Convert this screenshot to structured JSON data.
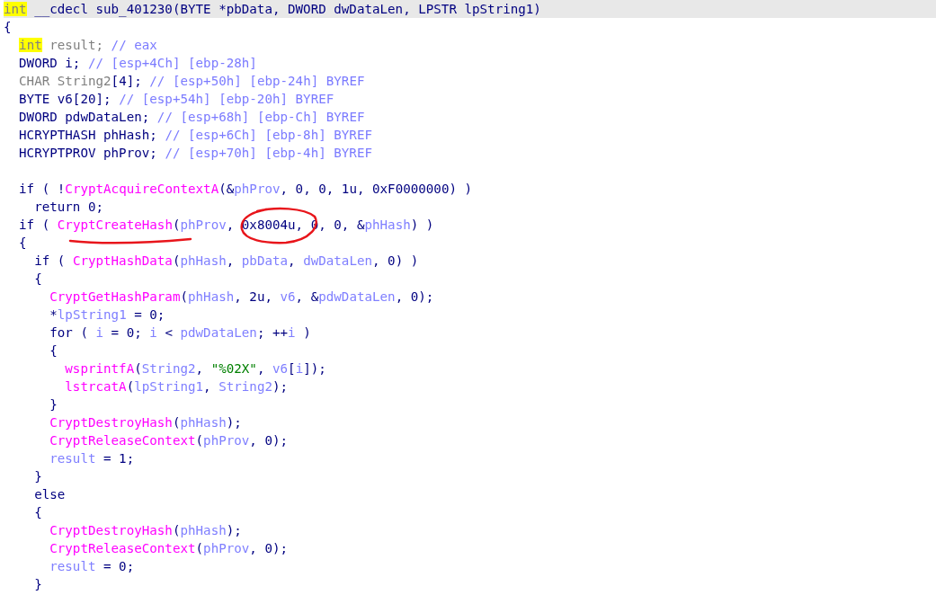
{
  "lines": [
    {
      "current": true,
      "tokens": [
        {
          "kind": "keyword",
          "t": "int"
        },
        {
          "kind": "plain",
          "t": " __cdecl sub_401230(BYTE *pbData, DWORD dwDataLen, LPSTR lpString1)"
        }
      ]
    },
    {
      "current": false,
      "tokens": [
        {
          "kind": "plain",
          "t": "{"
        }
      ]
    },
    {
      "current": false,
      "tokens": [
        {
          "kind": "keyword",
          "t": "  int"
        },
        {
          "kind": "type",
          "t": " result; "
        },
        {
          "kind": "comment",
          "t": "// eax"
        }
      ]
    },
    {
      "current": false,
      "tokens": [
        {
          "kind": "plain",
          "t": "  DWORD i; "
        },
        {
          "kind": "comment",
          "t": "// [esp+4Ch] [ebp-28h]"
        }
      ]
    },
    {
      "current": false,
      "tokens": [
        {
          "kind": "type",
          "t": "  CHAR String2"
        },
        {
          "kind": "plain",
          "t": "[4]; "
        },
        {
          "kind": "comment",
          "t": "// [esp+50h] [ebp-24h] BYREF"
        }
      ]
    },
    {
      "current": false,
      "tokens": [
        {
          "kind": "plain",
          "t": "  BYTE v6[20]; "
        },
        {
          "kind": "comment",
          "t": "// [esp+54h] [ebp-20h] BYREF"
        }
      ]
    },
    {
      "current": false,
      "tokens": [
        {
          "kind": "plain",
          "t": "  DWORD pdwDataLen; "
        },
        {
          "kind": "comment",
          "t": "// [esp+68h] [ebp-Ch] BYREF"
        }
      ]
    },
    {
      "current": false,
      "tokens": [
        {
          "kind": "plain",
          "t": "  HCRYPTHASH phHash; "
        },
        {
          "kind": "comment",
          "t": "// [esp+6Ch] [ebp-8h] BYREF"
        }
      ]
    },
    {
      "current": false,
      "tokens": [
        {
          "kind": "plain",
          "t": "  HCRYPTPROV phProv; "
        },
        {
          "kind": "comment",
          "t": "// [esp+70h] [ebp-4h] BYREF"
        }
      ]
    },
    {
      "current": false
    },
    {
      "current": false,
      "tokens": [
        {
          "kind": "plain",
          "t": "  if ( !"
        },
        {
          "kind": "function",
          "t": "CryptAcquireContextA"
        },
        {
          "kind": "plain",
          "t": "(&"
        },
        {
          "kind": "variable",
          "t": "phProv"
        },
        {
          "kind": "plain",
          "t": ", 0, 0, 1u, 0xF0000000) )"
        }
      ]
    },
    {
      "current": false,
      "tokens": [
        {
          "kind": "plain",
          "t": "    return 0;"
        }
      ]
    },
    {
      "current": false,
      "tokens": [
        {
          "kind": "plain",
          "t": "  if ( "
        },
        {
          "kind": "function",
          "t": "CryptCreateHash"
        },
        {
          "kind": "plain",
          "t": "("
        },
        {
          "kind": "variable",
          "t": "phProv"
        },
        {
          "kind": "plain",
          "t": ", 0x8004u, 0, 0, &"
        },
        {
          "kind": "variable",
          "t": "phHash"
        },
        {
          "kind": "plain",
          "t": ") )"
        }
      ]
    },
    {
      "current": false,
      "tokens": [
        {
          "kind": "plain",
          "t": "  {"
        }
      ]
    },
    {
      "current": false,
      "tokens": [
        {
          "kind": "plain",
          "t": "    if ( "
        },
        {
          "kind": "function",
          "t": "CryptHashData"
        },
        {
          "kind": "plain",
          "t": "("
        },
        {
          "kind": "variable",
          "t": "phHash"
        },
        {
          "kind": "plain",
          "t": ", "
        },
        {
          "kind": "variable",
          "t": "pbData"
        },
        {
          "kind": "plain",
          "t": ", "
        },
        {
          "kind": "variable",
          "t": "dwDataLen"
        },
        {
          "kind": "plain",
          "t": ", 0) )"
        }
      ]
    },
    {
      "current": false,
      "tokens": [
        {
          "kind": "plain",
          "t": "    {"
        }
      ]
    },
    {
      "current": false,
      "tokens": [
        {
          "kind": "function",
          "t": "      CryptGetHashParam"
        },
        {
          "kind": "plain",
          "t": "("
        },
        {
          "kind": "variable",
          "t": "phHash"
        },
        {
          "kind": "plain",
          "t": ", 2u, "
        },
        {
          "kind": "variable",
          "t": "v6"
        },
        {
          "kind": "plain",
          "t": ", &"
        },
        {
          "kind": "variable",
          "t": "pdwDataLen"
        },
        {
          "kind": "plain",
          "t": ", 0);"
        }
      ]
    },
    {
      "current": false,
      "tokens": [
        {
          "kind": "plain",
          "t": "      *"
        },
        {
          "kind": "variable",
          "t": "lpString1"
        },
        {
          "kind": "plain",
          "t": " = 0;"
        }
      ]
    },
    {
      "current": false,
      "tokens": [
        {
          "kind": "plain",
          "t": "      for ( "
        },
        {
          "kind": "variable",
          "t": "i"
        },
        {
          "kind": "plain",
          "t": " = 0; "
        },
        {
          "kind": "variable",
          "t": "i"
        },
        {
          "kind": "plain",
          "t": " < "
        },
        {
          "kind": "variable",
          "t": "pdwDataLen"
        },
        {
          "kind": "plain",
          "t": "; ++"
        },
        {
          "kind": "variable",
          "t": "i"
        },
        {
          "kind": "plain",
          "t": " )"
        }
      ]
    },
    {
      "current": false,
      "tokens": [
        {
          "kind": "plain",
          "t": "      {"
        }
      ]
    },
    {
      "current": false,
      "tokens": [
        {
          "kind": "function",
          "t": "        wsprintfA"
        },
        {
          "kind": "plain",
          "t": "("
        },
        {
          "kind": "variable",
          "t": "String2"
        },
        {
          "kind": "plain",
          "t": ", "
        },
        {
          "kind": "string",
          "t": "\"%02X\""
        },
        {
          "kind": "plain",
          "t": ", "
        },
        {
          "kind": "variable",
          "t": "v6"
        },
        {
          "kind": "plain",
          "t": "["
        },
        {
          "kind": "variable",
          "t": "i"
        },
        {
          "kind": "plain",
          "t": "]);"
        }
      ]
    },
    {
      "current": false,
      "tokens": [
        {
          "kind": "function",
          "t": "        lstrcatA"
        },
        {
          "kind": "plain",
          "t": "("
        },
        {
          "kind": "variable",
          "t": "lpString1"
        },
        {
          "kind": "plain",
          "t": ", "
        },
        {
          "kind": "variable",
          "t": "String2"
        },
        {
          "kind": "plain",
          "t": ");"
        }
      ]
    },
    {
      "current": false,
      "tokens": [
        {
          "kind": "plain",
          "t": "      }"
        }
      ]
    },
    {
      "current": false,
      "tokens": [
        {
          "kind": "function",
          "t": "      CryptDestroyHash"
        },
        {
          "kind": "plain",
          "t": "("
        },
        {
          "kind": "variable",
          "t": "phHash"
        },
        {
          "kind": "plain",
          "t": ");"
        }
      ]
    },
    {
      "current": false,
      "tokens": [
        {
          "kind": "function",
          "t": "      CryptReleaseContext"
        },
        {
          "kind": "plain",
          "t": "("
        },
        {
          "kind": "variable",
          "t": "phProv"
        },
        {
          "kind": "plain",
          "t": ", 0);"
        }
      ]
    },
    {
      "current": false,
      "tokens": [
        {
          "kind": "variable",
          "t": "      result"
        },
        {
          "kind": "plain",
          "t": " = 1;"
        }
      ]
    },
    {
      "current": false,
      "tokens": [
        {
          "kind": "plain",
          "t": "    }"
        }
      ]
    },
    {
      "current": false,
      "tokens": [
        {
          "kind": "plain",
          "t": "    else"
        }
      ]
    },
    {
      "current": false,
      "tokens": [
        {
          "kind": "plain",
          "t": "    {"
        }
      ]
    },
    {
      "current": false,
      "tokens": [
        {
          "kind": "function",
          "t": "      CryptDestroyHash"
        },
        {
          "kind": "plain",
          "t": "("
        },
        {
          "kind": "variable",
          "t": "phHash"
        },
        {
          "kind": "plain",
          "t": ");"
        }
      ]
    },
    {
      "current": false,
      "tokens": [
        {
          "kind": "function",
          "t": "      CryptReleaseContext"
        },
        {
          "kind": "plain",
          "t": "("
        },
        {
          "kind": "variable",
          "t": "phProv"
        },
        {
          "kind": "plain",
          "t": ", 0);"
        }
      ]
    },
    {
      "current": false,
      "tokens": [
        {
          "kind": "variable",
          "t": "      result"
        },
        {
          "kind": "plain",
          "t": " = 0;"
        }
      ]
    },
    {
      "current": false,
      "tokens": [
        {
          "kind": "plain",
          "t": "    }"
        }
      ]
    }
  ]
}
